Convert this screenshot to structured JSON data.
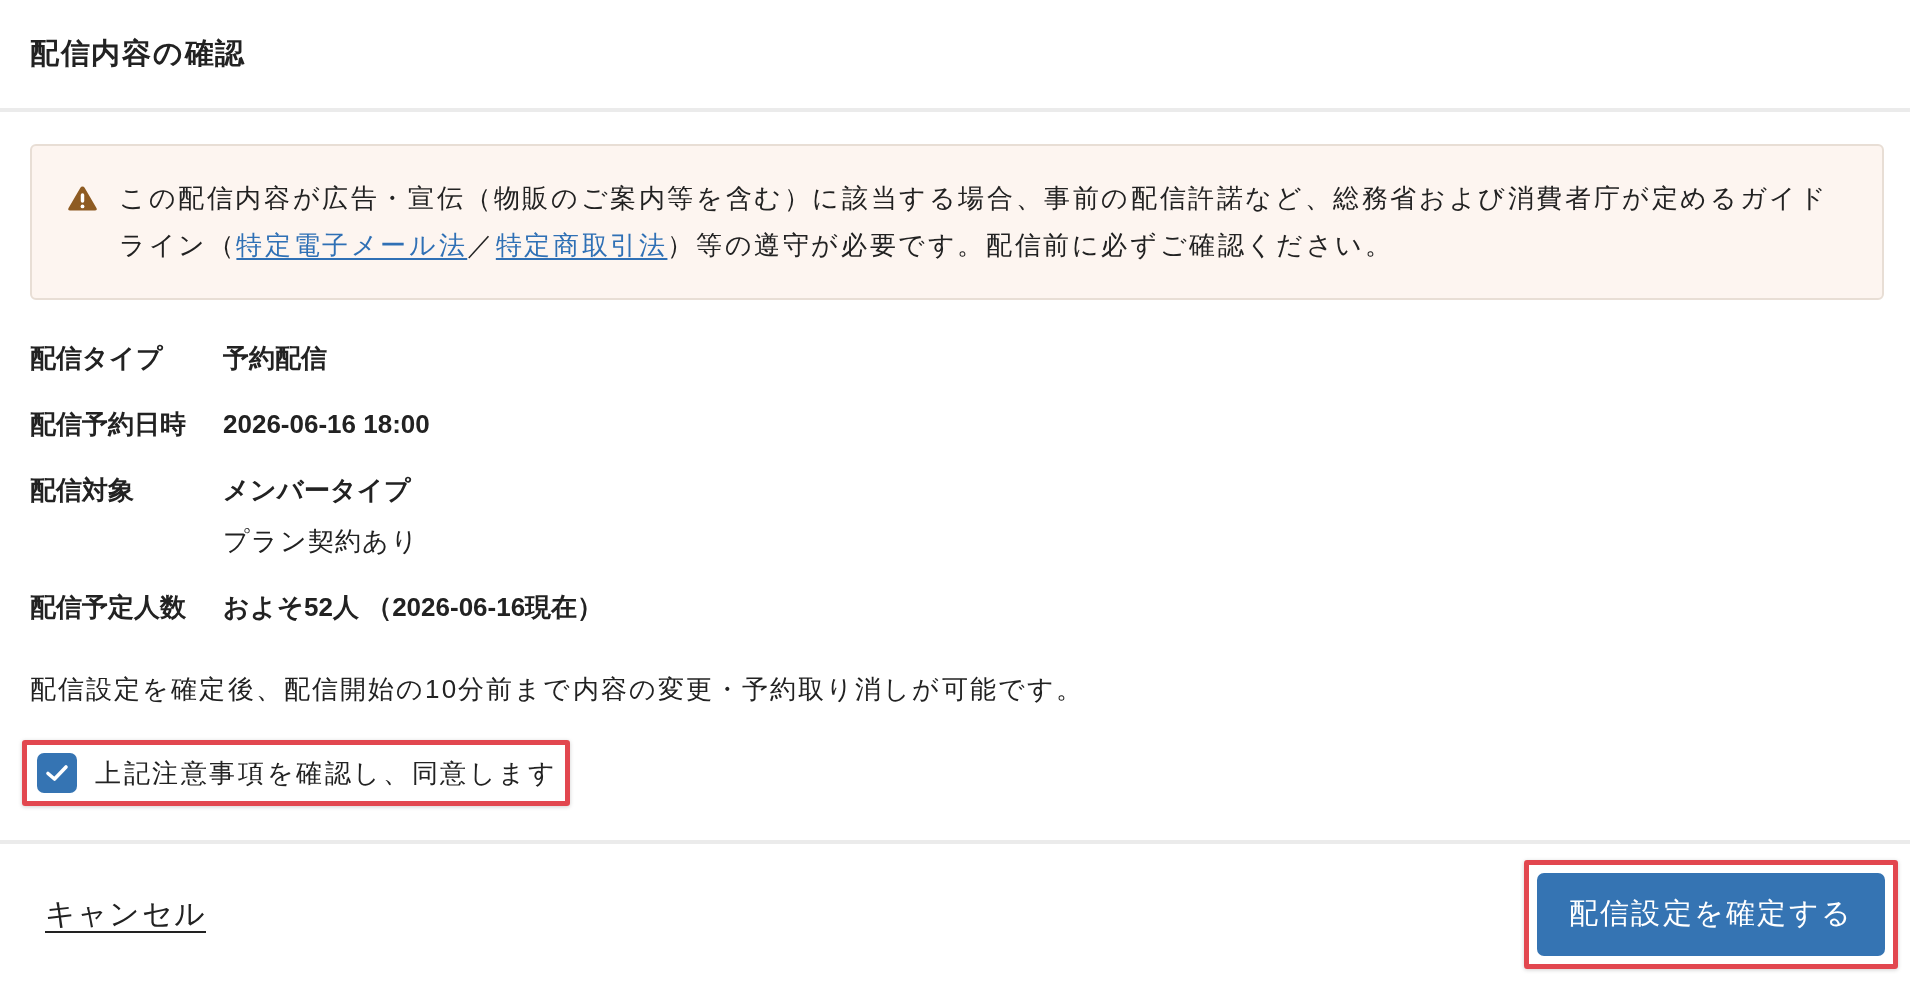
{
  "dialog": {
    "title": "配信内容の確認"
  },
  "notice": {
    "parts": [
      {
        "kind": "text",
        "text": "この配信内容が広告・宣伝（物販のご案内等を含む）に該当する場合、事前の配信許諾など、総務省および消費者庁が定めるガイドライン（"
      },
      {
        "kind": "link",
        "text": "特定電子メール法"
      },
      {
        "kind": "text",
        "text": "／"
      },
      {
        "kind": "link",
        "text": "特定商取引法"
      },
      {
        "kind": "text",
        "text": "）等の遵守が必要です。配信前に必ずご確認ください。"
      }
    ]
  },
  "details": [
    {
      "label": "配信タイプ",
      "values": [
        {
          "kind": "main",
          "text": "予約配信"
        }
      ]
    },
    {
      "label": "配信予約日時",
      "values": [
        {
          "kind": "main",
          "text": "2026-06-16 18:00"
        }
      ]
    },
    {
      "label": "配信対象",
      "values": [
        {
          "kind": "main",
          "text": "メンバータイプ"
        },
        {
          "kind": "sub",
          "text": "プラン契約あり"
        }
      ]
    },
    {
      "label": "配信予定人数",
      "values": [
        {
          "kind": "main",
          "text": "およそ52人 （2026-06-16現在）"
        }
      ]
    }
  ],
  "note": "配信設定を確定後、配信開始の10分前まで内容の変更・予約取り消しが可能です。",
  "agreement": {
    "label": "上記注意事項を確認し、同意します",
    "checked": true,
    "highlighted": true
  },
  "footer": {
    "cancel_link": {
      "label": "キャンセル"
    },
    "confirm_button": {
      "label": "配信設定を確定する",
      "highlighted": true
    }
  }
}
